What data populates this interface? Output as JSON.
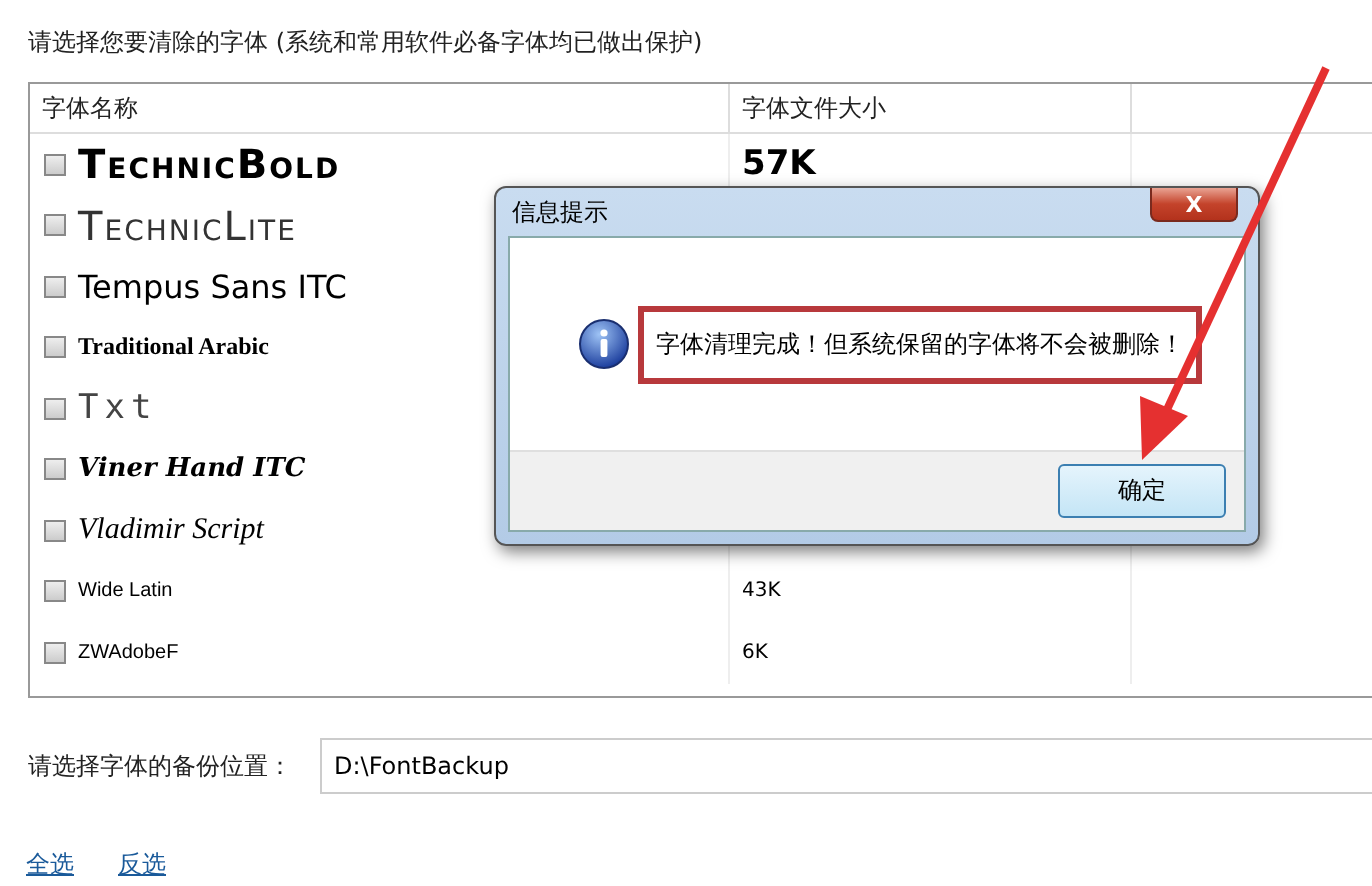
{
  "instruction": "请选择您要清除的字体 (系统和常用软件必备字体均已做出保护)",
  "table": {
    "columns": [
      "字体名称",
      "字体文件大小"
    ],
    "rows": [
      {
        "name": "TechnicBold",
        "size": "57K",
        "checked": false
      },
      {
        "name": "TechnicLite",
        "checked": false
      },
      {
        "name": "Tempus Sans ITC",
        "checked": false
      },
      {
        "name": "Traditional Arabic",
        "checked": false
      },
      {
        "name": "Txt",
        "checked": false
      },
      {
        "name": "Viner Hand ITC",
        "checked": false
      },
      {
        "name": "Vladimir Script",
        "checked": false
      },
      {
        "name": "Wide Latin",
        "size": "43K",
        "checked": false
      },
      {
        "name": "ZWAdobeF",
        "size": "6K",
        "checked": false
      }
    ]
  },
  "backup": {
    "label": "请选择字体的备份位置：",
    "value": "D:\\FontBackup"
  },
  "links": [
    "全选",
    "反选"
  ],
  "dialog": {
    "title": "信息提示",
    "close": "X",
    "message": "字体清理完成！但系统保留的字体将不会被删除！",
    "button": "确定"
  }
}
